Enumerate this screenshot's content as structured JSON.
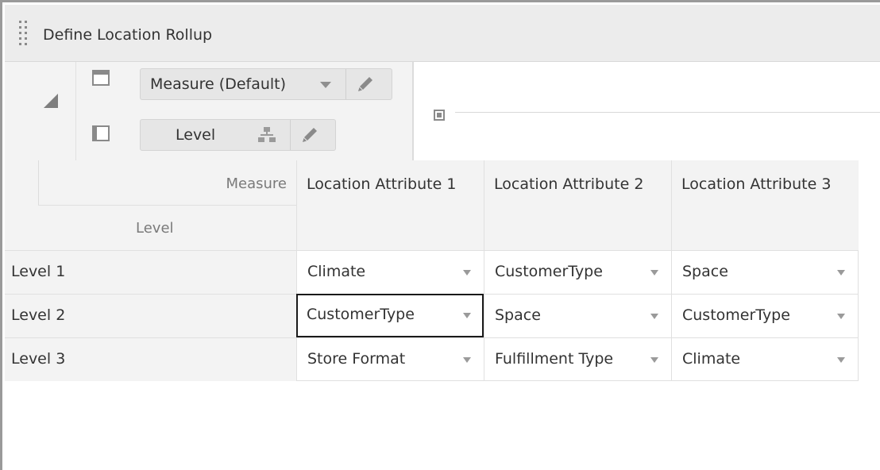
{
  "window": {
    "title": "Define Location Rollup"
  },
  "pivot": {
    "row_edge_chip": {
      "label": "Measure (Default)"
    },
    "column_edge_chip": {
      "label": "Level"
    }
  },
  "grid": {
    "corner": {
      "measure_label": "Measure",
      "level_label": "Level"
    },
    "columns": [
      "Location Attribute 1",
      "Location Attribute 2",
      "Location Attribute 3"
    ],
    "rows": [
      {
        "label": "Level 1",
        "values": [
          "Climate",
          "CustomerType",
          "Space"
        ]
      },
      {
        "label": "Level 2",
        "values": [
          "CustomerType",
          "Space",
          "CustomerType"
        ]
      },
      {
        "label": "Level 3",
        "values": [
          "Store Format",
          "Fulfillment Type",
          "Climate"
        ]
      }
    ],
    "focused_cell": {
      "row": 2,
      "column": 1
    }
  },
  "icons": {
    "drag_handle": "drag-handle-icon",
    "collapse": "collapse-triangle-icon",
    "rows_edge": "rows-layout-icon",
    "columns_edge": "columns-layout-icon",
    "edit": "pencil-icon",
    "hierarchy": "hierarchy-icon",
    "dropdown": "chevron-down-icon",
    "page_edge": "page-edge-icon"
  },
  "colors": {
    "header_bg": "#ececec",
    "pivot_bg": "#f3f3f3",
    "chip_bg": "#e6e6e6",
    "focus_border": "#1a1a1a"
  }
}
